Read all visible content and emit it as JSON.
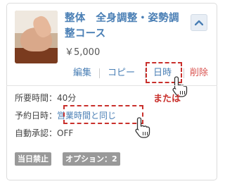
{
  "service": {
    "title": "整体　全身調整・姿勢調整コース",
    "price": "￥5,000"
  },
  "actions": {
    "edit": "編集",
    "copy": "コピー",
    "schedule": "日時",
    "delete": "削除"
  },
  "details": {
    "duration_label": "所要時間：",
    "duration_value": "40分",
    "booking_label": "予約日時：",
    "booking_value": "営業時間と同じ",
    "auto_approval_label": "自動承認：",
    "auto_approval_value": "OFF"
  },
  "annotation": {
    "or_text": "または"
  },
  "badges": {
    "same_day": "当日禁止",
    "options": "オプション：2"
  },
  "colors": {
    "link": "#4a7fb5",
    "delete": "#d9534f",
    "highlight": "#c9302c",
    "badge": "#999999"
  },
  "icons": {
    "collapse": "chevron-up-icon",
    "pointer": "hand-pointer-icon"
  }
}
